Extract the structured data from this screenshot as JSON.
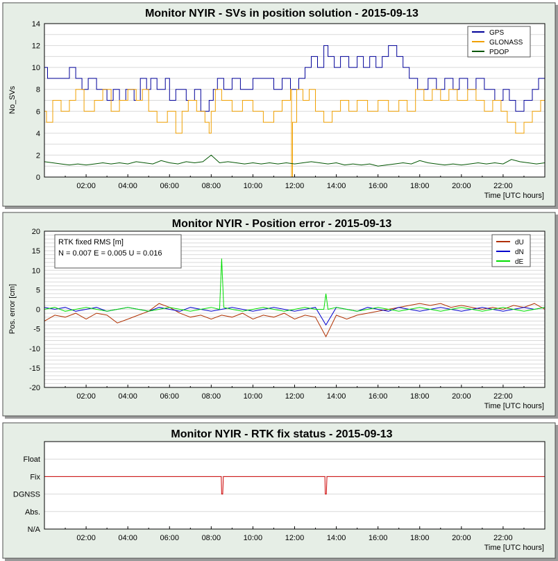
{
  "charts": [
    {
      "title": "Monitor NYIR  -  SVs in position solution  -  2015-09-13",
      "xlabel": "Time [UTC hours]",
      "ylabel": "No_SVs",
      "xlim": [
        0,
        24
      ],
      "ylim": [
        0,
        14
      ],
      "xticks": [
        2,
        4,
        6,
        8,
        10,
        12,
        14,
        16,
        18,
        20,
        22
      ],
      "xticklabels": [
        "02:00",
        "04:00",
        "06:00",
        "08:00",
        "10:00",
        "12:00",
        "14:00",
        "16:00",
        "18:00",
        "20:00",
        "22:00"
      ],
      "yticks": [
        0,
        2,
        4,
        6,
        8,
        10,
        12,
        14
      ],
      "yticklabels": [
        "0",
        "2",
        "4",
        "6",
        "8",
        "10",
        "12",
        "14"
      ],
      "legend": [
        "GPS",
        "GLONASS",
        "PDOP"
      ],
      "colors": {
        "GPS": "#000099",
        "GLONASS": "#f0a000",
        "PDOP": "#005500"
      }
    },
    {
      "title": "Monitor NYIR  -  Position error  -  2015-09-13",
      "xlabel": "Time [UTC hours]",
      "ylabel": "Pos. error [cm]",
      "xlim": [
        0,
        24
      ],
      "ylim": [
        -20,
        20
      ],
      "xticks": [
        2,
        4,
        6,
        8,
        10,
        12,
        14,
        16,
        18,
        20,
        22
      ],
      "xticklabels": [
        "02:00",
        "04:00",
        "06:00",
        "08:00",
        "10:00",
        "12:00",
        "14:00",
        "16:00",
        "18:00",
        "20:00",
        "22:00"
      ],
      "yticks": [
        -20,
        -15,
        -10,
        -5,
        0,
        5,
        10,
        15,
        20
      ],
      "yticklabels": [
        "-20",
        "-15",
        "-10",
        "-5",
        "0",
        "5",
        "10",
        "15",
        "20"
      ],
      "legend": [
        "dU",
        "dN",
        "dE"
      ],
      "colors": {
        "dU": "#b03000",
        "dN": "#0000cc",
        "dE": "#00dd00"
      },
      "note_line1": "RTK fixed RMS [m]",
      "note_line2": "N = 0.007  E = 0.005 U = 0.016"
    },
    {
      "title": "Monitor NYIR  -  RTK fix status  -  2015-09-13",
      "xlabel": "Time [UTC hours]",
      "xlim": [
        0,
        24
      ],
      "xticks": [
        2,
        4,
        6,
        8,
        10,
        12,
        14,
        16,
        18,
        20,
        22
      ],
      "xticklabels": [
        "02:00",
        "04:00",
        "06:00",
        "08:00",
        "10:00",
        "12:00",
        "14:00",
        "16:00",
        "18:00",
        "20:00",
        "22:00"
      ],
      "levels": [
        "N/A",
        "Abs.",
        "DGNSS",
        "Fix",
        "Float"
      ],
      "colors": {
        "status": "#cc0000"
      }
    }
  ],
  "chart_data": [
    {
      "type": "line",
      "title": "Monitor NYIR  -  SVs in position solution  -  2015-09-13",
      "xlabel": "Time [UTC hours]",
      "ylabel": "No_SVs",
      "xlim": [
        0,
        24
      ],
      "ylim": [
        0,
        14
      ],
      "grid": true,
      "legend_position": "top-right",
      "series": [
        {
          "name": "GPS",
          "x": [
            0,
            0.15,
            1.2,
            1.5,
            1.8,
            2.1,
            2.5,
            3.0,
            3.3,
            3.6,
            3.9,
            4.3,
            4.6,
            4.9,
            5.1,
            5.4,
            5.8,
            6.0,
            6.3,
            6.8,
            7.2,
            7.5,
            7.9,
            8.1,
            8.3,
            8.6,
            9.0,
            9.4,
            10.0,
            10.6,
            11.0,
            11.4,
            11.8,
            12.2,
            12.5,
            12.8,
            13.1,
            13.4,
            13.6,
            13.9,
            14.2,
            14.6,
            15.0,
            15.3,
            15.6,
            15.9,
            16.2,
            16.5,
            16.9,
            17.2,
            17.5,
            17.9,
            18.4,
            18.8,
            19.2,
            19.6,
            19.9,
            20.3,
            20.7,
            21.1,
            21.6,
            22.0,
            22.3,
            22.6,
            23.0,
            23.4,
            23.7,
            24.0
          ],
          "values": [
            10,
            9,
            10,
            9,
            8,
            9,
            8,
            7,
            8,
            7,
            8,
            7,
            9,
            8,
            9,
            8,
            9,
            7,
            8,
            7,
            8,
            6,
            7,
            8,
            9,
            8,
            9,
            8,
            9,
            9,
            8,
            9,
            8,
            9,
            10,
            11,
            10,
            12,
            11,
            10,
            11,
            10,
            11,
            10,
            11,
            10,
            11,
            12,
            11,
            10,
            9,
            8,
            9,
            8,
            9,
            8,
            9,
            8,
            9,
            8,
            7,
            8,
            7,
            6,
            7,
            8,
            9,
            10
          ]
        },
        {
          "name": "GLONASS",
          "x": [
            0,
            0.1,
            0.4,
            0.8,
            1.2,
            1.5,
            1.9,
            2.4,
            2.8,
            3.2,
            3.6,
            4.0,
            4.4,
            4.7,
            5.0,
            5.4,
            5.9,
            6.3,
            6.6,
            6.9,
            7.3,
            7.7,
            7.9,
            8.0,
            8.2,
            8.5,
            9.0,
            9.5,
            10.0,
            10.5,
            11.0,
            11.4,
            11.8,
            11.85,
            11.9,
            12.1,
            12.4,
            12.7,
            13.0,
            13.4,
            13.8,
            14.2,
            14.6,
            15.0,
            15.5,
            16.0,
            16.5,
            17.0,
            17.4,
            17.8,
            18.2,
            18.6,
            19.0,
            19.4,
            19.8,
            20.3,
            20.7,
            21.1,
            21.5,
            21.9,
            22.2,
            22.6,
            23.0,
            23.4,
            23.8,
            24.0
          ],
          "values": [
            6,
            5,
            7,
            6,
            7,
            8,
            6,
            7,
            8,
            6,
            7,
            8,
            7,
            8,
            6,
            5,
            6,
            4,
            6,
            7,
            6,
            5,
            4,
            6,
            8,
            7,
            6,
            7,
            6,
            5,
            6,
            7,
            8,
            0,
            5,
            8,
            7,
            8,
            6,
            5,
            6,
            7,
            6,
            7,
            6,
            7,
            6,
            7,
            6,
            8,
            7,
            8,
            7,
            8,
            7,
            8,
            7,
            6,
            7,
            6,
            5,
            4,
            5,
            6,
            7,
            6
          ]
        },
        {
          "name": "PDOP",
          "x": [
            0,
            0.4,
            0.8,
            1.2,
            1.6,
            2.0,
            2.4,
            2.8,
            3.2,
            3.6,
            4.0,
            4.4,
            4.8,
            5.2,
            5.6,
            6.0,
            6.4,
            6.8,
            7.2,
            7.6,
            8.0,
            8.4,
            8.8,
            9.2,
            9.6,
            10.0,
            10.4,
            10.8,
            11.2,
            11.6,
            12.0,
            12.4,
            12.8,
            13.2,
            13.6,
            14.0,
            14.4,
            14.8,
            15.2,
            15.6,
            16.0,
            16.4,
            16.8,
            17.2,
            17.6,
            18.0,
            18.4,
            18.8,
            19.2,
            19.6,
            20.0,
            20.4,
            20.8,
            21.2,
            21.6,
            22.0,
            22.4,
            22.8,
            23.2,
            23.6,
            24.0
          ],
          "values": [
            1.4,
            1.3,
            1.2,
            1.1,
            1.2,
            1.1,
            1.2,
            1.3,
            1.2,
            1.3,
            1.2,
            1.4,
            1.3,
            1.2,
            1.5,
            1.3,
            1.2,
            1.4,
            1.3,
            1.4,
            2.0,
            1.3,
            1.4,
            1.3,
            1.2,
            1.3,
            1.2,
            1.3,
            1.2,
            1.3,
            1.2,
            1.3,
            1.4,
            1.3,
            1.2,
            1.3,
            1.1,
            1.2,
            1.1,
            1.2,
            1.0,
            1.1,
            1.2,
            1.3,
            1.2,
            1.5,
            1.3,
            1.2,
            1.1,
            1.2,
            1.1,
            1.2,
            1.3,
            1.2,
            1.3,
            1.2,
            1.6,
            1.4,
            1.3,
            1.2,
            1.3
          ]
        }
      ]
    },
    {
      "type": "line",
      "title": "Monitor NYIR  -  Position error  -  2015-09-13",
      "xlabel": "Time [UTC hours]",
      "ylabel": "Pos. error [cm]",
      "xlim": [
        0,
        24
      ],
      "ylim": [
        -20,
        20
      ],
      "grid": true,
      "legend_position": "top-right",
      "series": [
        {
          "name": "dU",
          "x": [
            0,
            0.5,
            1.0,
            1.5,
            2.0,
            2.5,
            3.0,
            3.5,
            4.0,
            4.5,
            5.0,
            5.5,
            6.0,
            6.5,
            7.0,
            7.5,
            8.0,
            8.5,
            9.0,
            9.5,
            10.0,
            10.5,
            11.0,
            11.5,
            12.0,
            12.5,
            13.0,
            13.5,
            14.0,
            14.5,
            15.0,
            15.5,
            16.0,
            16.5,
            17.0,
            17.5,
            18.0,
            18.5,
            19.0,
            19.5,
            20.0,
            20.5,
            21.0,
            21.5,
            22.0,
            22.5,
            23.0,
            23.5,
            24.0
          ],
          "values": [
            -3,
            -1.5,
            -2,
            -1,
            -2.5,
            -1,
            -1.5,
            -3.5,
            -2.5,
            -1.5,
            -0.5,
            1.5,
            0.5,
            -1,
            -2,
            -1.5,
            -2.5,
            -1.5,
            -2,
            -1,
            -2.5,
            -1.5,
            -2,
            -1,
            -2.5,
            -1.5,
            -2,
            -7,
            -1.5,
            -2.5,
            -1.5,
            -1,
            -0.5,
            0,
            0.5,
            1,
            1.5,
            1,
            1.5,
            0.5,
            1,
            0.5,
            0,
            0.5,
            0,
            1,
            0.5,
            1.5,
            0
          ]
        },
        {
          "name": "dN",
          "x": [
            0,
            0.5,
            1.0,
            1.5,
            2.0,
            2.5,
            3.0,
            3.5,
            4.0,
            4.5,
            5.0,
            5.5,
            6.0,
            6.5,
            7.0,
            7.5,
            8.0,
            8.5,
            9.0,
            9.5,
            10.0,
            10.5,
            11.0,
            11.5,
            12.0,
            12.5,
            13.0,
            13.5,
            14.0,
            14.5,
            15.0,
            15.5,
            16.0,
            16.5,
            17.0,
            17.5,
            18.0,
            18.5,
            19.0,
            19.5,
            20.0,
            20.5,
            21.0,
            21.5,
            22.0,
            22.5,
            23.0,
            23.5,
            24.0
          ],
          "values": [
            0.5,
            0,
            0.5,
            -0.5,
            0,
            0.5,
            -0.5,
            0,
            0.5,
            0,
            -0.5,
            0.5,
            0,
            -0.5,
            0.5,
            0,
            -0.5,
            0,
            0.5,
            0,
            -0.5,
            0,
            0.5,
            0,
            -0.5,
            0,
            0.5,
            -4,
            0.5,
            0,
            -0.5,
            0.5,
            0,
            -0.5,
            0.5,
            0,
            -0.5,
            0,
            0.5,
            0,
            -0.5,
            0,
            0.5,
            0,
            -0.5,
            0,
            0.5,
            0,
            0.5
          ]
        },
        {
          "name": "dE",
          "x": [
            0,
            0.5,
            1.0,
            1.5,
            2.0,
            2.5,
            3.0,
            3.5,
            4.0,
            4.5,
            5.0,
            5.5,
            6.0,
            6.5,
            7.0,
            7.5,
            8.0,
            8.4,
            8.5,
            8.6,
            9.0,
            9.5,
            10.0,
            10.5,
            11.0,
            11.5,
            12.0,
            12.5,
            13.0,
            13.4,
            13.5,
            13.6,
            14.0,
            14.5,
            15.0,
            15.5,
            16.0,
            16.5,
            17.0,
            17.5,
            18.0,
            18.5,
            19.0,
            19.5,
            20.0,
            20.5,
            21.0,
            21.5,
            22.0,
            22.5,
            23.0,
            23.5,
            24.0
          ],
          "values": [
            0,
            0.5,
            -0.5,
            0,
            0.5,
            0,
            -0.5,
            0,
            0.5,
            0,
            -0.5,
            0,
            0.5,
            0,
            -0.5,
            0,
            0.5,
            0,
            13,
            0.5,
            0,
            -0.5,
            0,
            0.5,
            0,
            -0.5,
            0,
            0.5,
            0,
            0,
            4,
            0,
            0.5,
            0,
            -0.5,
            0,
            0.5,
            0,
            -0.5,
            0,
            0.5,
            0,
            -0.5,
            0,
            0.5,
            0,
            -0.5,
            0,
            0.5,
            0,
            -0.5,
            0,
            0.5
          ]
        }
      ]
    },
    {
      "type": "line",
      "title": "Monitor NYIR  -  RTK fix status  -  2015-09-13",
      "xlabel": "Time [UTC hours]",
      "ylabel": "",
      "xlim": [
        0,
        24
      ],
      "categories_y": [
        "N/A",
        "Abs.",
        "DGNSS",
        "Fix",
        "Float"
      ],
      "grid": true,
      "series": [
        {
          "name": "",
          "x": [
            0,
            8.48,
            8.5,
            8.55,
            8.58,
            13.45,
            13.47,
            13.52,
            13.55,
            24
          ],
          "values": [
            "Fix",
            "Fix",
            "DGNSS",
            "DGNSS",
            "Fix",
            "Fix",
            "DGNSS",
            "DGNSS",
            "Fix",
            "Fix"
          ]
        }
      ]
    }
  ]
}
